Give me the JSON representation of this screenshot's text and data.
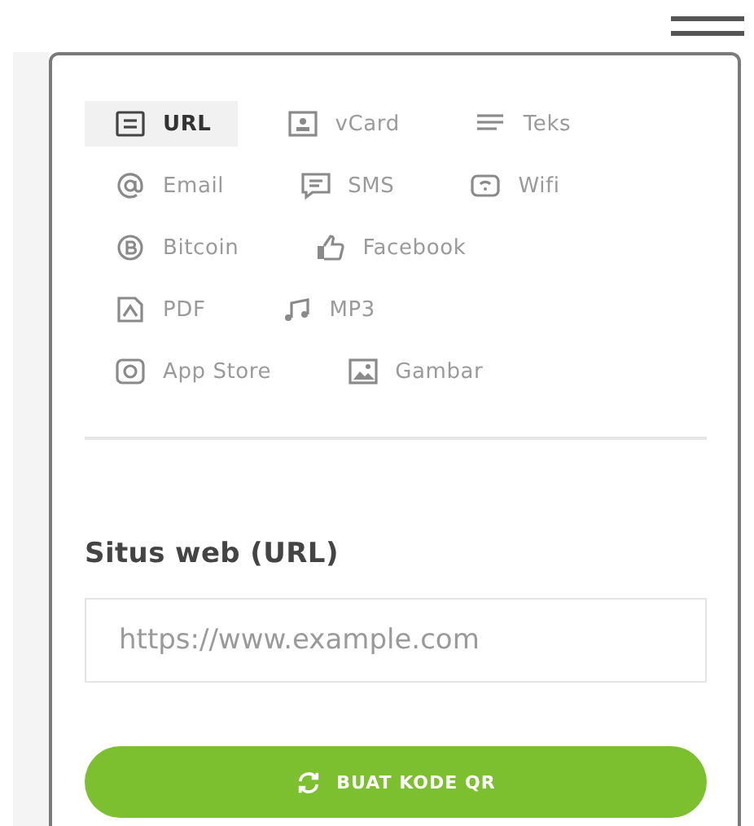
{
  "menu": {
    "kind": "hamburger"
  },
  "type_rows": [
    [
      {
        "kind": "url",
        "label": "URL",
        "selected": true
      },
      {
        "kind": "vcard",
        "label": "vCard",
        "selected": false
      },
      {
        "kind": "text",
        "label": "Teks",
        "selected": false
      }
    ],
    [
      {
        "kind": "email",
        "label": "Email",
        "selected": false
      },
      {
        "kind": "sms",
        "label": "SMS",
        "selected": false
      },
      {
        "kind": "wifi",
        "label": "Wifi",
        "selected": false
      }
    ],
    [
      {
        "kind": "bitcoin",
        "label": "Bitcoin",
        "selected": false
      },
      {
        "kind": "facebook",
        "label": "Facebook",
        "selected": false
      }
    ],
    [
      {
        "kind": "pdf",
        "label": "PDF",
        "selected": false
      },
      {
        "kind": "mp3",
        "label": "MP3",
        "selected": false
      }
    ],
    [
      {
        "kind": "appstore",
        "label": "App Store",
        "selected": false
      },
      {
        "kind": "image",
        "label": "Gambar",
        "selected": false
      }
    ]
  ],
  "field": {
    "label": "Situs web (URL)",
    "placeholder": "https://www.example.com"
  },
  "button": {
    "label": "BUAT KODE QR"
  }
}
